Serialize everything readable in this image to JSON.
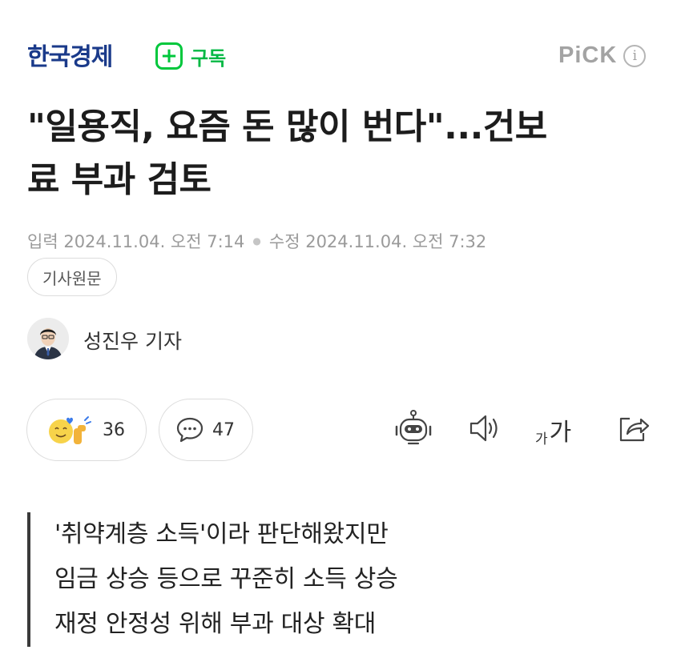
{
  "header": {
    "press_name": "한국경제",
    "subscribe_label": "구독",
    "pick_label": "PiCK",
    "info_icon": "info-icon"
  },
  "article": {
    "title_line1": "\"일용직, 요즘 돈 많이 번다\"...건보",
    "title_line2": "료 부과 검토",
    "published_label": "입력",
    "published": "2024.11.04. 오전 7:14",
    "modified_label": "수정",
    "modified": "2024.11.04. 오전 7:32",
    "original_button": "기사원문",
    "reporter": "성진우 기자"
  },
  "reactions": {
    "like_count": "36",
    "comment_count": "47",
    "font_small": "가",
    "font_big": "가"
  },
  "summary": [
    "'취약계층 소득'이라 판단해왔지만",
    "임금 상승 등으로 꾸준히 소득 상승",
    "재정 안정성 위해 부과 대상 확대"
  ],
  "colors": {
    "accent_green": "#00c73c",
    "press_blue": "#1a3a8a",
    "muted": "#9a9a9a"
  }
}
